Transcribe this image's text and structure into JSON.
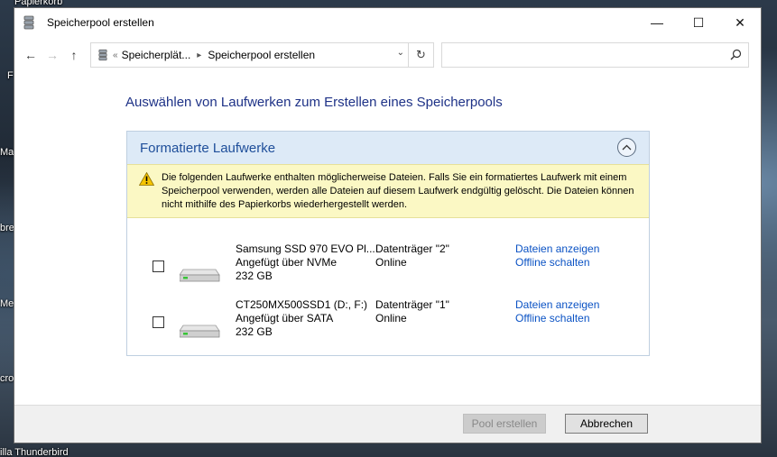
{
  "desktop": {
    "labels": [
      "Papierkorb",
      "F",
      "Ma",
      "bre",
      "Mer",
      "cro",
      "illa Thunderbird"
    ]
  },
  "window": {
    "title": "Speicherpool erstellen",
    "controls": {
      "minimize": "—",
      "maximize": "☐",
      "close": "✕"
    }
  },
  "nav": {
    "back": "←",
    "forward": "→",
    "up": "↑",
    "address": {
      "chevron": "«",
      "segments": [
        "Speicherplät...",
        "Speicherpool erstellen"
      ]
    },
    "search": {
      "placeholder": ""
    }
  },
  "main": {
    "heading": "Auswählen von Laufwerken zum Erstellen eines Speicherpools",
    "group": {
      "title": "Formatierte Laufwerke",
      "warning": "Die folgenden Laufwerke enthalten möglicherweise Dateien. Falls Sie ein formatiertes Laufwerk mit einem Speicherpool verwenden, werden alle Dateien auf diesem Laufwerk endgültig gelöscht. Die Dateien können nicht mithilfe des Papierkorbs wiederhergestellt werden.",
      "drives": [
        {
          "name": "Samsung SSD 970 EVO Pl...",
          "connection": "Angefügt über NVMe",
          "size": "232 GB",
          "disk": "Datenträger \"2\"",
          "status": "Online",
          "action1": "Dateien anzeigen",
          "action2": "Offline schalten",
          "checked": false
        },
        {
          "name": "CT250MX500SSD1 (D:, F:)",
          "connection": "Angefügt über SATA",
          "size": "232 GB",
          "disk": "Datenträger \"1\"",
          "status": "Online",
          "action1": "Dateien anzeigen",
          "action2": "Offline schalten",
          "checked": false
        }
      ]
    }
  },
  "footer": {
    "create_label": "Pool erstellen",
    "cancel_label": "Abbrechen"
  }
}
